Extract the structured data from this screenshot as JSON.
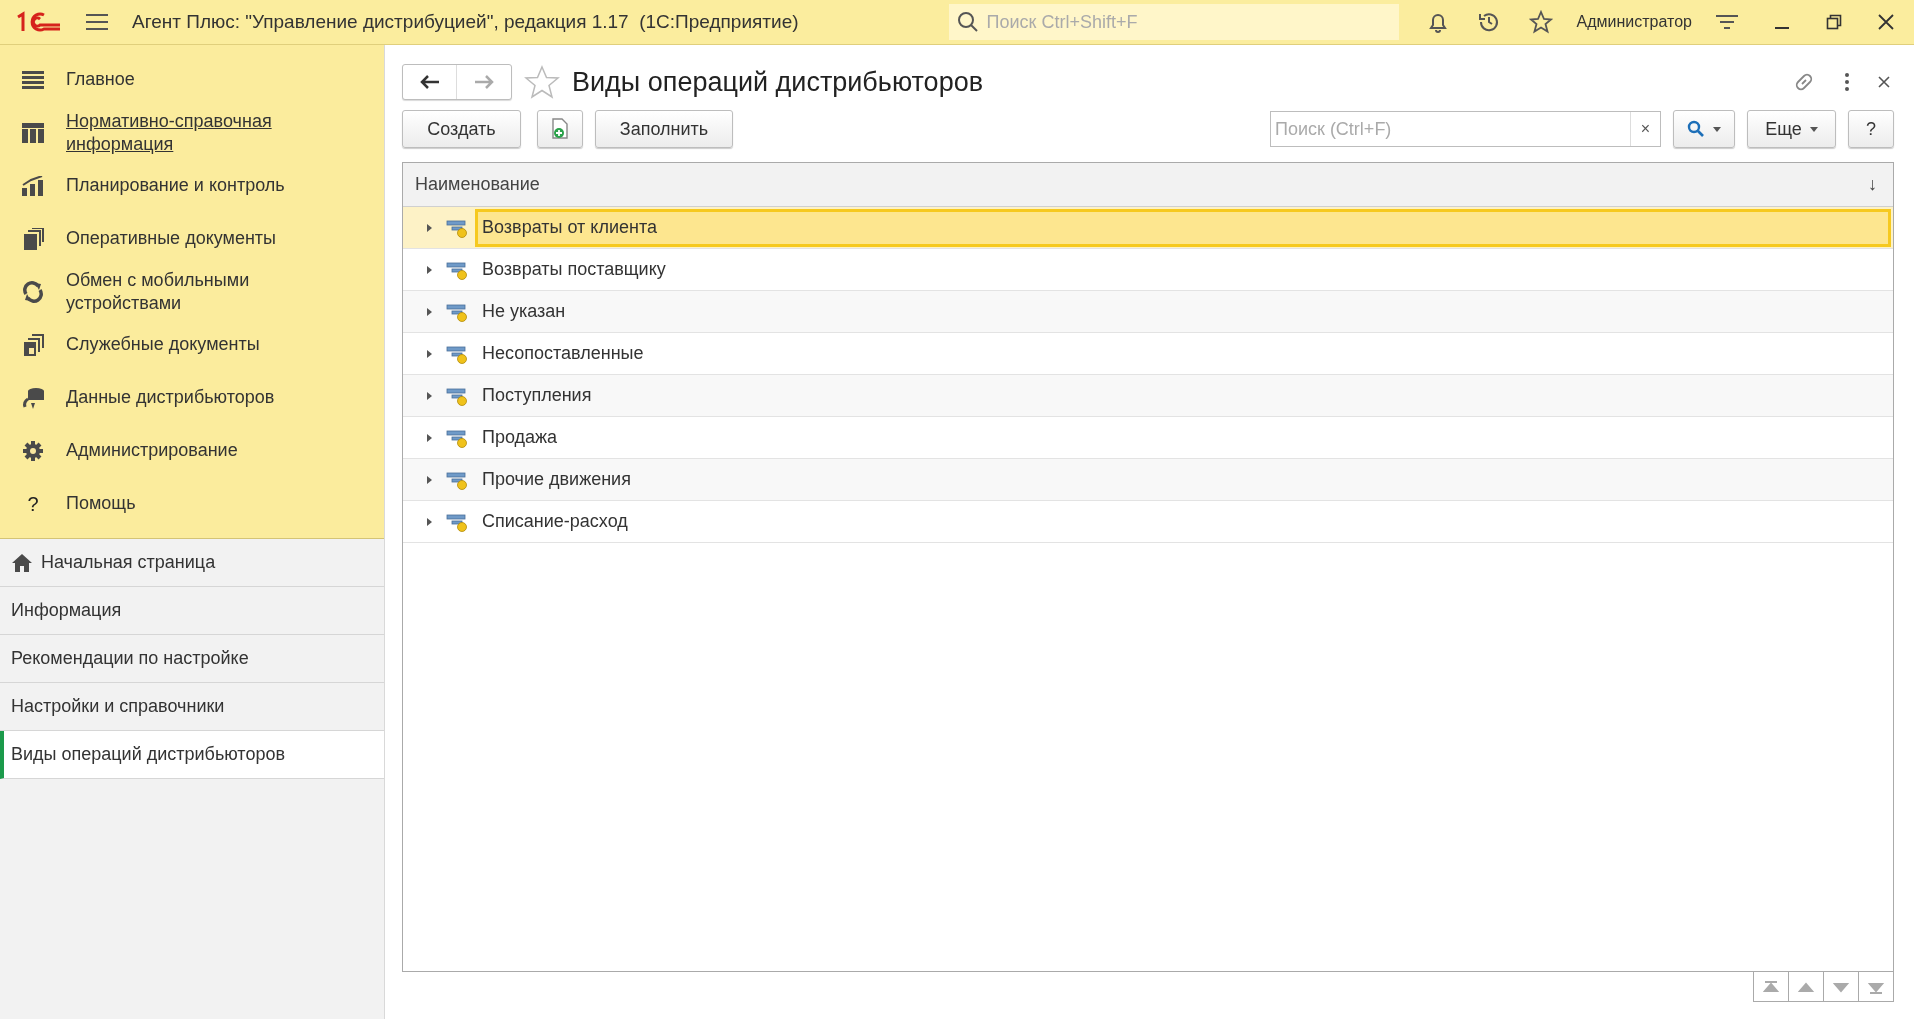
{
  "window": {
    "title": "Агент Плюс: \"Управление дистрибуцией\", редакция 1.17  (1С:Предприятие)",
    "search_placeholder": "Поиск Ctrl+Shift+F",
    "user": "Администратор"
  },
  "sections": [
    {
      "label": "Главное",
      "kind": "menu",
      "hovered": false
    },
    {
      "label": "Нормативно-справочная информация",
      "kind": "catalog",
      "hovered": true
    },
    {
      "label": "Планирование и контроль",
      "kind": "chart",
      "hovered": false
    },
    {
      "label": "Оперативные документы",
      "kind": "docs",
      "hovered": false
    },
    {
      "label": "Обмен с мобильными устройствами",
      "kind": "sync",
      "hovered": false
    },
    {
      "label": "Служебные документы",
      "kind": "service",
      "hovered": false
    },
    {
      "label": "Данные дистрибьюторов",
      "kind": "data",
      "hovered": false
    },
    {
      "label": "Администрирование",
      "kind": "gear",
      "hovered": false
    },
    {
      "label": "Помощь",
      "kind": "glyph",
      "glyph": "?",
      "hovered": false
    }
  ],
  "open_pages": [
    {
      "label": "Начальная страница",
      "kind": "home",
      "selected": false
    },
    {
      "label": "Информация",
      "kind": "page",
      "selected": false
    },
    {
      "label": "Рекомендации по настройке",
      "kind": "page",
      "selected": false
    },
    {
      "label": "Настройки и справочники",
      "kind": "page",
      "selected": false
    },
    {
      "label": "Виды операций дистрибьюторов",
      "kind": "page",
      "selected": true
    }
  ],
  "form": {
    "title": "Виды операций дистрибьюторов",
    "create_button": "Создать",
    "fill_button": "Заполнить",
    "search_placeholder": "Поиск (Ctrl+F)",
    "clear_glyph": "×",
    "more_button": "Еще",
    "help_button": "?"
  },
  "table": {
    "column": "Наименование",
    "sort_glyph": "↓",
    "rows": [
      {
        "name": "Возвраты от клиента",
        "selected": true,
        "expanded": false
      },
      {
        "name": "Возвраты поставщику",
        "selected": false,
        "expanded": false
      },
      {
        "name": "Не указан",
        "selected": false,
        "expanded": false
      },
      {
        "name": "Несопоставленные",
        "selected": false,
        "expanded": false
      },
      {
        "name": "Поступления",
        "selected": false,
        "expanded": false
      },
      {
        "name": "Продажа",
        "selected": false,
        "expanded": false
      },
      {
        "name": "Прочие движения",
        "selected": false,
        "expanded": false
      },
      {
        "name": "Списание-расход",
        "selected": false,
        "expanded": false
      }
    ]
  }
}
